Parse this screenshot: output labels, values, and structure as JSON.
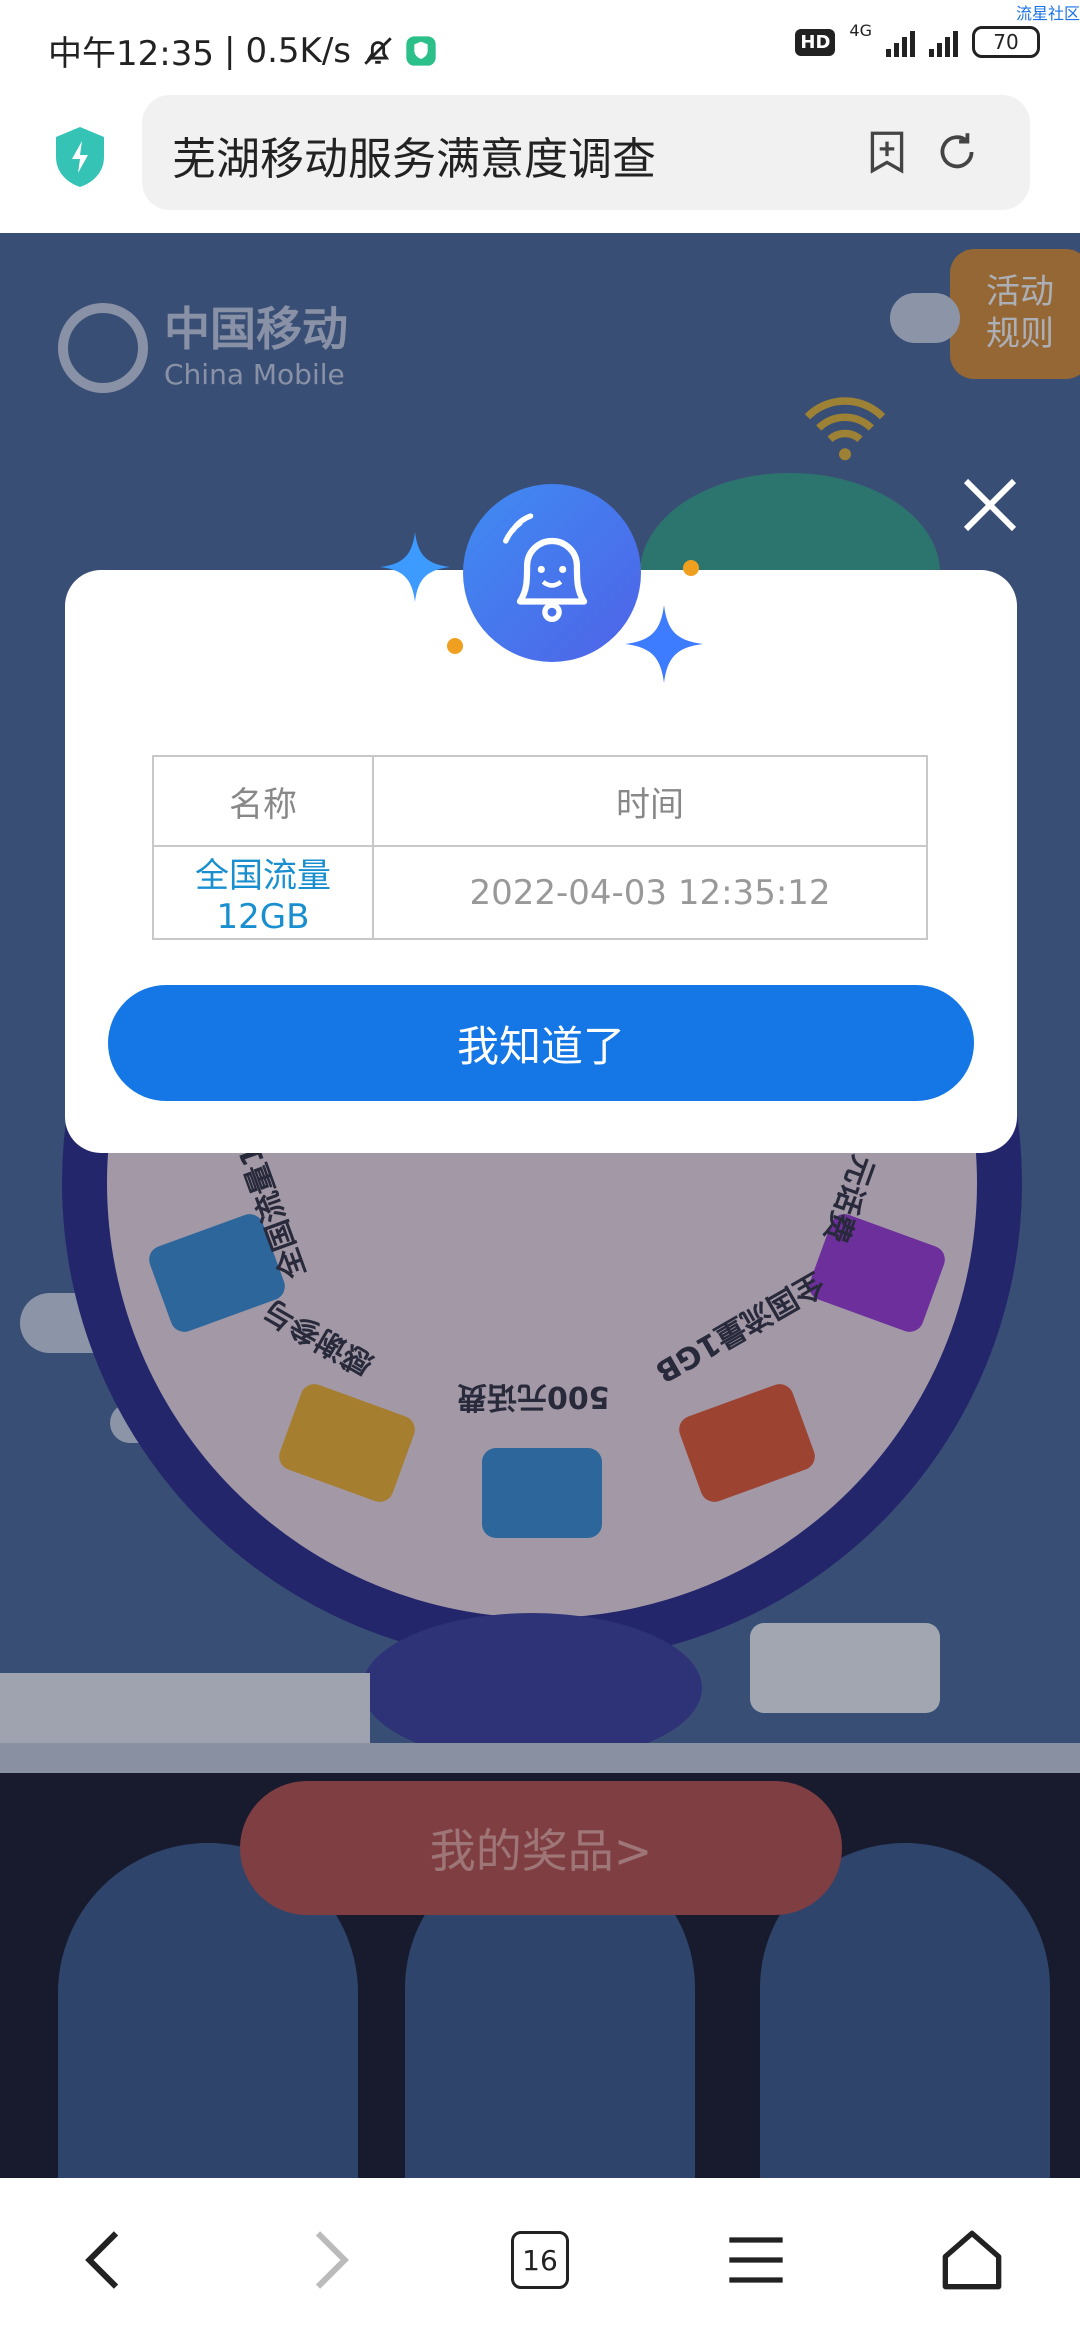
{
  "status_bar": {
    "time": "中午12:35",
    "speed": "0.5K/s",
    "network": "4G",
    "hd": "HD",
    "battery": "70"
  },
  "watermark": "流星社区",
  "browser": {
    "page_title": "芜湖移动服务满意度调查",
    "tab_count": "16"
  },
  "page": {
    "brand_cn": "中国移动",
    "brand_en": "China Mobile",
    "rules_button": "活动\n规则",
    "wheel_labels": [
      "全国流量1GB",
      "感谢参与",
      "500元话费",
      "全国流量1GB",
      "元话费"
    ],
    "my_prizes_button": "我的奖品>"
  },
  "dialog": {
    "table_headers": [
      "名称",
      "时间"
    ],
    "rows": [
      {
        "name": "全国流量12GB",
        "time": "2022-04-03 12:35:12"
      }
    ],
    "confirm_button": "我知道了"
  },
  "colors": {
    "primary_button": "#1577e6",
    "prize_name": "#1a8fd0",
    "page_bg": "#4d6b9b"
  }
}
